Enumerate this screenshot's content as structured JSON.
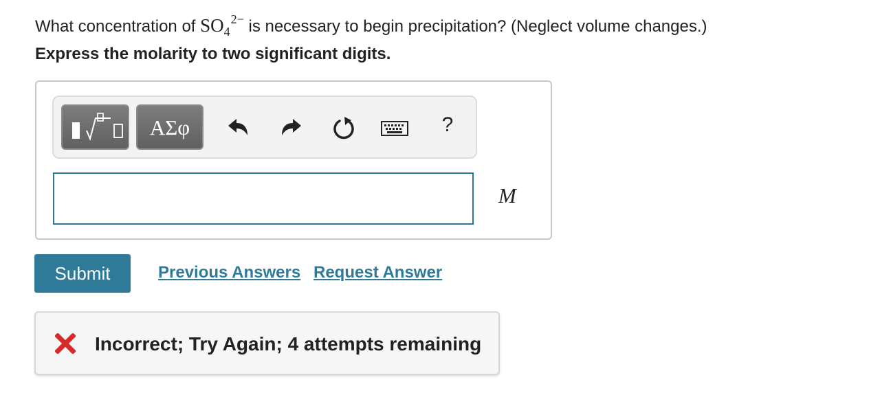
{
  "question": {
    "prefix": "What concentration of ",
    "formula_base": "SO",
    "formula_subscript": "4",
    "formula_charge": "2−",
    "suffix": " is necessary to begin precipitation? (Neglect volume changes.)"
  },
  "instruction": "Express the molarity to two significant digits.",
  "toolbar": {
    "greek_label": "ΑΣφ",
    "help_label": "?",
    "icons": [
      "templates-icon",
      "greek-symbols-icon",
      "undo-icon",
      "redo-icon",
      "reset-icon",
      "keyboard-icon",
      "help-icon"
    ]
  },
  "answer": {
    "value": "",
    "placeholder": "",
    "unit": "M"
  },
  "actions": {
    "submit_label": "Submit",
    "previous_answers_label": "Previous Answers",
    "request_answer_label": "Request Answer"
  },
  "feedback": {
    "text": "Incorrect; Try Again; 4 attempts remaining",
    "status_color": "#d52b2b"
  },
  "colors": {
    "accent": "#2f7a98",
    "input_border": "#2f7697"
  }
}
